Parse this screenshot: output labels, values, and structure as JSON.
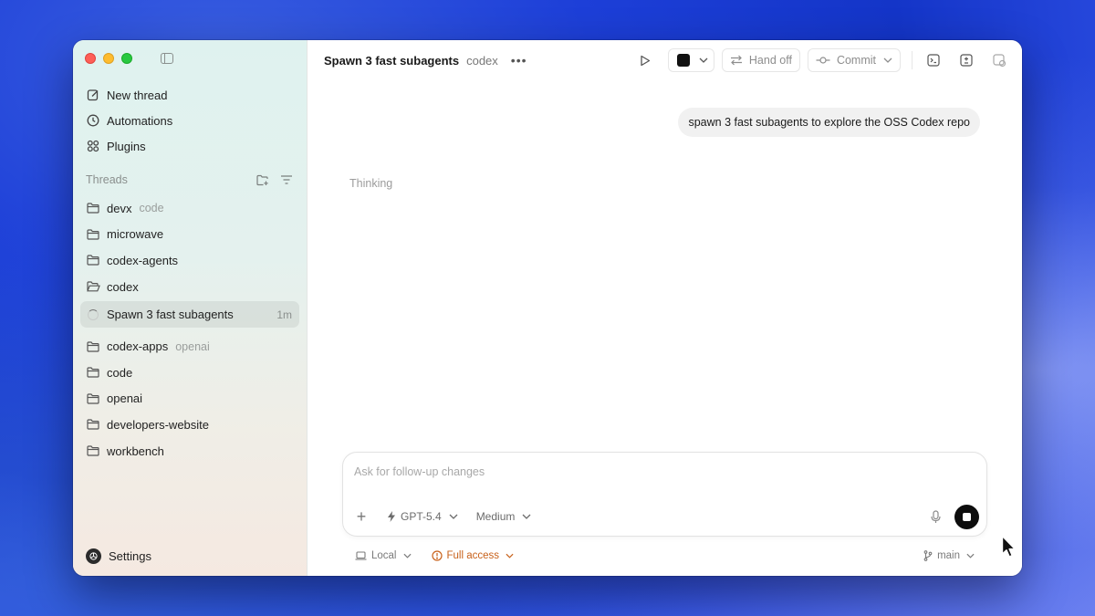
{
  "sidebar": {
    "nav": [
      {
        "label": "New thread",
        "icon": "edit-icon"
      },
      {
        "label": "Automations",
        "icon": "clock-icon"
      },
      {
        "label": "Plugins",
        "icon": "grid-icon"
      }
    ],
    "threads_label": "Threads",
    "threads": [
      {
        "label": "devx",
        "sub": "code"
      },
      {
        "label": "microwave",
        "sub": ""
      },
      {
        "label": "codex-agents",
        "sub": ""
      },
      {
        "label": "codex",
        "sub": ""
      }
    ],
    "active_thread": {
      "label": "Spawn 3 fast subagents",
      "time": "1m"
    },
    "threads_after": [
      {
        "label": "codex-apps",
        "sub": "openai"
      },
      {
        "label": "code",
        "sub": ""
      },
      {
        "label": "openai",
        "sub": ""
      },
      {
        "label": "developers-website",
        "sub": ""
      },
      {
        "label": "workbench",
        "sub": ""
      }
    ],
    "settings_label": "Settings"
  },
  "header": {
    "title": "Spawn 3 fast subagents",
    "project": "codex",
    "hand_off": "Hand off",
    "commit": "Commit"
  },
  "conversation": {
    "user_message": "spawn 3 fast subagents to explore the OSS Codex repo",
    "status": "Thinking"
  },
  "composer": {
    "placeholder": "Ask for follow-up changes",
    "model": "GPT-5.4",
    "reasoning": "Medium"
  },
  "footer": {
    "environment": "Local",
    "access": "Full access",
    "branch": "main"
  },
  "colors": {
    "accent_warning": "#c8611a",
    "stop_button": "#0d0d0d"
  }
}
